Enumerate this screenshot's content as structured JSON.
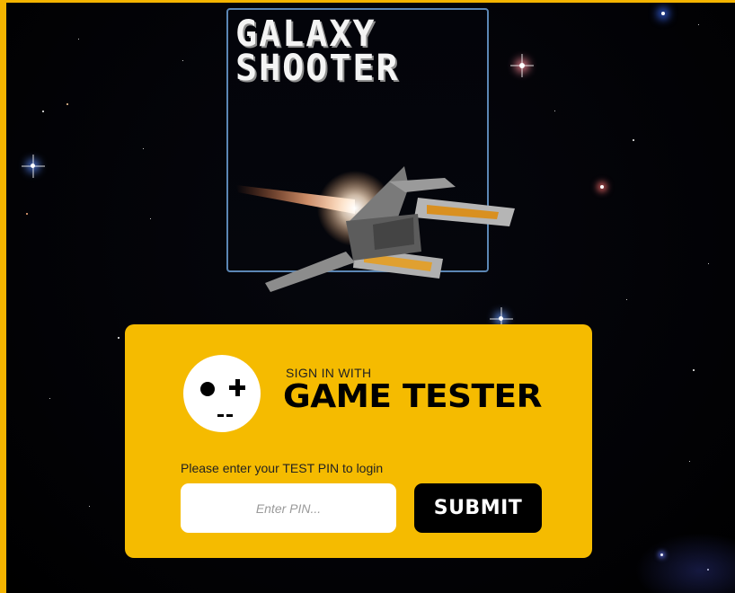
{
  "game": {
    "title_line1": "GALAXY",
    "title_line2": "SHOOTER",
    "ship_image": "spaceship-icon"
  },
  "login": {
    "pre_label": "SIGN IN WITH",
    "brand_name": "GAME TESTER",
    "brand_logo": "controller-face-icon",
    "pin_prompt": "Please enter your TEST PIN to login",
    "pin_placeholder": "Enter PIN...",
    "pin_value": "",
    "submit_label": "SUBMIT"
  },
  "colors": {
    "page_border": "#f4b400",
    "card_background": "#f5bb00",
    "logo_border": "#5b86b4",
    "space_background": "#000000",
    "button_background": "#000000",
    "button_text": "#ffffff"
  }
}
